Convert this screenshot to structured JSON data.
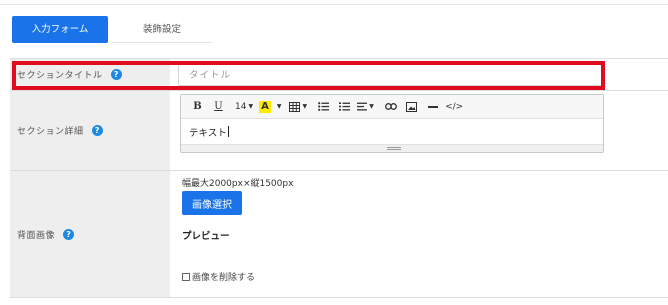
{
  "tabs": {
    "input_form": "入力フォーム",
    "decoration_settings": "装飾設定"
  },
  "fields": {
    "section_title": {
      "label": "セクションタイトル",
      "placeholder": "タイトル"
    },
    "section_detail": {
      "label": "セクション詳細",
      "content": "テキスト",
      "toolbar": {
        "bold": "B",
        "underline": "U",
        "font_size": "14",
        "font_color": "A"
      }
    },
    "background_image": {
      "label": "背面画像",
      "size_note": "幅最大2000px×縦1500px",
      "select_button": "画像選択",
      "preview_label": "プレビュー",
      "delete_checkbox_label": "画像を削除する"
    }
  },
  "colors": {
    "primary": "#1a73e8",
    "highlight": "#e00b1f",
    "help_icon": "#1e88e5",
    "label_background": "#eeeeee"
  }
}
